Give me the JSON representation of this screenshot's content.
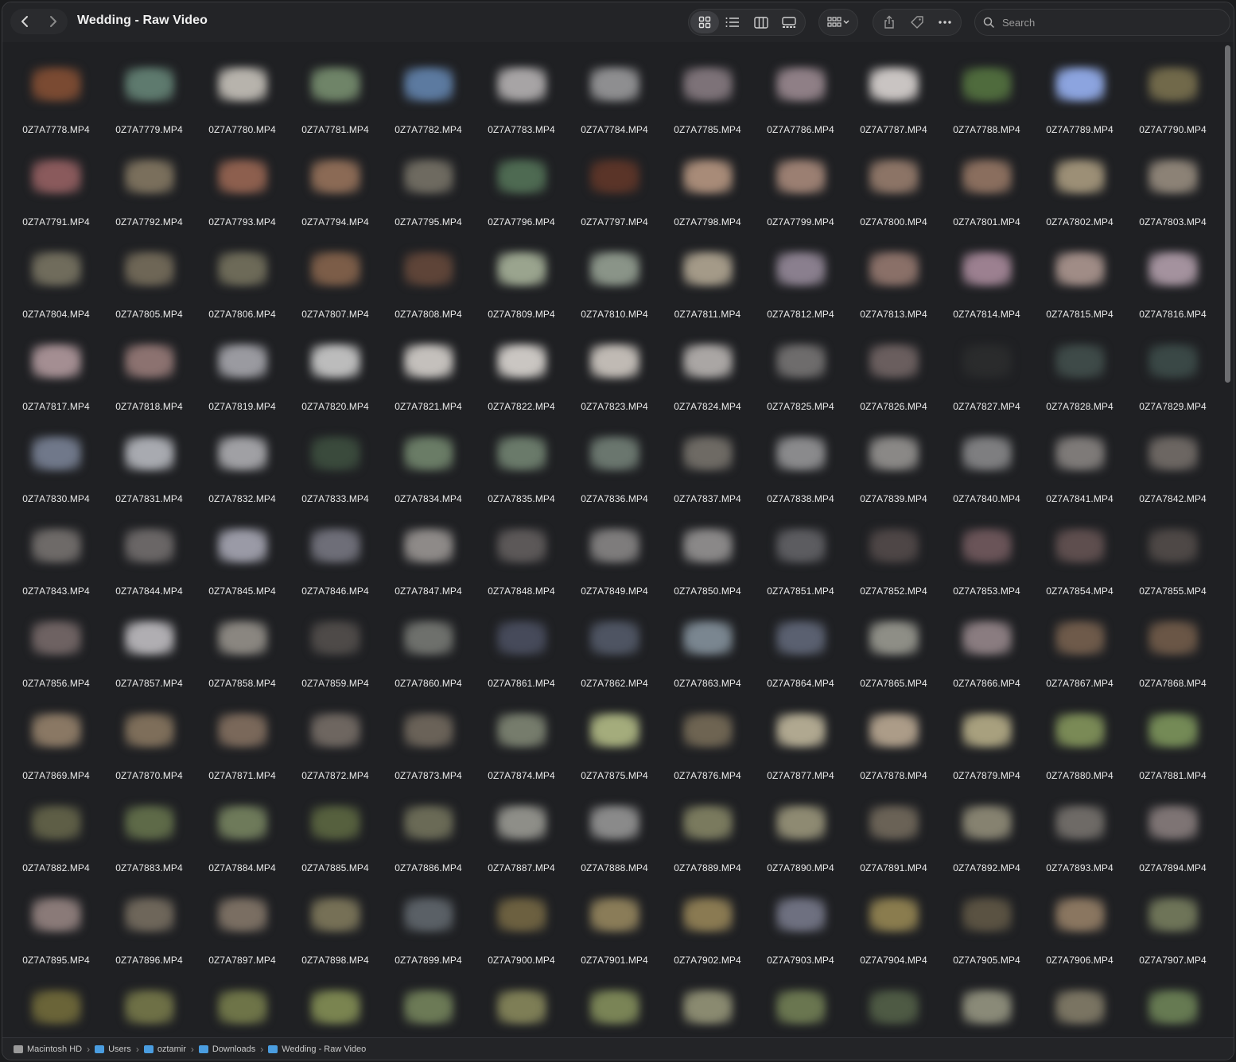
{
  "window": {
    "title": "Wedding - Raw Video"
  },
  "toolbar": {
    "back_icon": "chevron-left-icon",
    "forward_icon": "chevron-right-icon",
    "view_icons": [
      "icon-view-icon",
      "list-view-icon",
      "column-view-icon",
      "gallery-view-icon"
    ],
    "group_icon": "group-by-icon",
    "share_icon": "share-icon",
    "tag_icon": "tag-icon",
    "more_icon": "ellipsis-icon"
  },
  "search": {
    "placeholder": "Search"
  },
  "files": [
    {
      "name": "0Z7A7778.MP4",
      "color": "#7a4a32"
    },
    {
      "name": "0Z7A7779.MP4",
      "color": "#5e7a6e"
    },
    {
      "name": "0Z7A7780.MP4",
      "color": "#b7b3ac"
    },
    {
      "name": "0Z7A7781.MP4",
      "color": "#6f8468"
    },
    {
      "name": "0Z7A7782.MP4",
      "color": "#5c7aa0"
    },
    {
      "name": "0Z7A7783.MP4",
      "color": "#a7a4a5"
    },
    {
      "name": "0Z7A7784.MP4",
      "color": "#8e8e90"
    },
    {
      "name": "0Z7A7785.MP4",
      "color": "#7d7278"
    },
    {
      "name": "0Z7A7786.MP4",
      "color": "#8f7f86"
    },
    {
      "name": "0Z7A7787.MP4",
      "color": "#c9c4c2"
    },
    {
      "name": "0Z7A7788.MP4",
      "color": "#4f6b3d"
    },
    {
      "name": "0Z7A7789.MP4",
      "color": "#8ca4df"
    },
    {
      "name": "0Z7A7790.MP4",
      "color": "#71694a"
    },
    {
      "name": "0Z7A7791.MP4",
      "color": "#8a5a5c"
    },
    {
      "name": "0Z7A7792.MP4",
      "color": "#7a6f5c"
    },
    {
      "name": "0Z7A7793.MP4",
      "color": "#8d5f4e"
    },
    {
      "name": "0Z7A7794.MP4",
      "color": "#8b6a55"
    },
    {
      "name": "0Z7A7795.MP4",
      "color": "#6e6a60"
    },
    {
      "name": "0Z7A7796.MP4",
      "color": "#4e6a52"
    },
    {
      "name": "0Z7A7797.MP4",
      "color": "#5a3428"
    },
    {
      "name": "0Z7A7798.MP4",
      "color": "#a88b78"
    },
    {
      "name": "0Z7A7799.MP4",
      "color": "#9b7f72"
    },
    {
      "name": "0Z7A7800.MP4",
      "color": "#8c7466"
    },
    {
      "name": "0Z7A7801.MP4",
      "color": "#8a6e5e"
    },
    {
      "name": "0Z7A7802.MP4",
      "color": "#9c8f76"
    },
    {
      "name": "0Z7A7803.MP4",
      "color": "#8c8276"
    },
    {
      "name": "0Z7A7804.MP4",
      "color": "#706c5c"
    },
    {
      "name": "0Z7A7805.MP4",
      "color": "#6e6656"
    },
    {
      "name": "0Z7A7806.MP4",
      "color": "#6d6a58"
    },
    {
      "name": "0Z7A7807.MP4",
      "color": "#7c5d48"
    },
    {
      "name": "0Z7A7808.MP4",
      "color": "#5e4438"
    },
    {
      "name": "0Z7A7809.MP4",
      "color": "#9aa48e"
    },
    {
      "name": "0Z7A7810.MP4",
      "color": "#8a9488"
    },
    {
      "name": "0Z7A7811.MP4",
      "color": "#a49a88"
    },
    {
      "name": "0Z7A7812.MP4",
      "color": "#8a7f8e"
    },
    {
      "name": "0Z7A7813.MP4",
      "color": "#8a7068"
    },
    {
      "name": "0Z7A7814.MP4",
      "color": "#9c8090"
    },
    {
      "name": "0Z7A7815.MP4",
      "color": "#a08c86"
    },
    {
      "name": "0Z7A7816.MP4",
      "color": "#a4929e"
    },
    {
      "name": "0Z7A7817.MP4",
      "color": "#a48e92"
    },
    {
      "name": "0Z7A7818.MP4",
      "color": "#8c7270"
    },
    {
      "name": "0Z7A7819.MP4",
      "color": "#9a9aa0"
    },
    {
      "name": "0Z7A7820.MP4",
      "color": "#bcbcbc"
    },
    {
      "name": "0Z7A7821.MP4",
      "color": "#c4c0bc"
    },
    {
      "name": "0Z7A7822.MP4",
      "color": "#cac6c2"
    },
    {
      "name": "0Z7A7823.MP4",
      "color": "#c0bab4"
    },
    {
      "name": "0Z7A7824.MP4",
      "color": "#aaa6a4"
    },
    {
      "name": "0Z7A7825.MP4",
      "color": "#6e6c6c"
    },
    {
      "name": "0Z7A7826.MP4",
      "color": "#6a5e5e"
    },
    {
      "name": "0Z7A7827.MP4",
      "color": "#2a2b2c"
    },
    {
      "name": "0Z7A7828.MP4",
      "color": "#3e4a48"
    },
    {
      "name": "0Z7A7829.MP4",
      "color": "#3a4846"
    },
    {
      "name": "0Z7A7830.MP4",
      "color": "#70788a"
    },
    {
      "name": "0Z7A7831.MP4",
      "color": "#a8aab0"
    },
    {
      "name": "0Z7A7832.MP4",
      "color": "#a0a0a4"
    },
    {
      "name": "0Z7A7833.MP4",
      "color": "#3a4a3c"
    },
    {
      "name": "0Z7A7834.MP4",
      "color": "#6a7c66"
    },
    {
      "name": "0Z7A7835.MP4",
      "color": "#6a7a6a"
    },
    {
      "name": "0Z7A7836.MP4",
      "color": "#6a766e"
    },
    {
      "name": "0Z7A7837.MP4",
      "color": "#6e6a64"
    },
    {
      "name": "0Z7A7838.MP4",
      "color": "#8a8a8c"
    },
    {
      "name": "0Z7A7839.MP4",
      "color": "#8a8886"
    },
    {
      "name": "0Z7A7840.MP4",
      "color": "#7e7e80"
    },
    {
      "name": "0Z7A7841.MP4",
      "color": "#7e7a78"
    },
    {
      "name": "0Z7A7842.MP4",
      "color": "#6c6662"
    },
    {
      "name": "0Z7A7843.MP4",
      "color": "#6e6a68"
    },
    {
      "name": "0Z7A7844.MP4",
      "color": "#6a6666"
    },
    {
      "name": "0Z7A7845.MP4",
      "color": "#9a9aa6"
    },
    {
      "name": "0Z7A7846.MP4",
      "color": "#6e6e78"
    },
    {
      "name": "0Z7A7847.MP4",
      "color": "#8e8a88"
    },
    {
      "name": "0Z7A7848.MP4",
      "color": "#5c5858"
    },
    {
      "name": "0Z7A7849.MP4",
      "color": "#7e7c7c"
    },
    {
      "name": "0Z7A7850.MP4",
      "color": "#8a8888"
    },
    {
      "name": "0Z7A7851.MP4",
      "color": "#5c5c60"
    },
    {
      "name": "0Z7A7852.MP4",
      "color": "#4e4646"
    },
    {
      "name": "0Z7A7853.MP4",
      "color": "#6a5458"
    },
    {
      "name": "0Z7A7854.MP4",
      "color": "#5e4e4e"
    },
    {
      "name": "0Z7A7855.MP4",
      "color": "#4e4846"
    },
    {
      "name": "0Z7A7856.MP4",
      "color": "#6e6262"
    },
    {
      "name": "0Z7A7857.MP4",
      "color": "#b0aeb2"
    },
    {
      "name": "0Z7A7858.MP4",
      "color": "#8a8680"
    },
    {
      "name": "0Z7A7859.MP4",
      "color": "#4e4a48"
    },
    {
      "name": "0Z7A7860.MP4",
      "color": "#6e706c"
    },
    {
      "name": "0Z7A7861.MP4",
      "color": "#464a5a"
    },
    {
      "name": "0Z7A7862.MP4",
      "color": "#4e5462"
    },
    {
      "name": "0Z7A7863.MP4",
      "color": "#7a8690"
    },
    {
      "name": "0Z7A7864.MP4",
      "color": "#5a6070"
    },
    {
      "name": "0Z7A7865.MP4",
      "color": "#8e8e86"
    },
    {
      "name": "0Z7A7866.MP4",
      "color": "#8a7c80"
    },
    {
      "name": "0Z7A7867.MP4",
      "color": "#6e5a4a"
    },
    {
      "name": "0Z7A7868.MP4",
      "color": "#6a5646"
    },
    {
      "name": "0Z7A7869.MP4",
      "color": "#8a7864"
    },
    {
      "name": "0Z7A7870.MP4",
      "color": "#7e6e5a"
    },
    {
      "name": "0Z7A7871.MP4",
      "color": "#7a685a"
    },
    {
      "name": "0Z7A7872.MP4",
      "color": "#6e6660"
    },
    {
      "name": "0Z7A7873.MP4",
      "color": "#6a6258"
    },
    {
      "name": "0Z7A7874.MP4",
      "color": "#767c6c"
    },
    {
      "name": "0Z7A7875.MP4",
      "color": "#a4ac7c"
    },
    {
      "name": "0Z7A7876.MP4",
      "color": "#6e6452"
    },
    {
      "name": "0Z7A7877.MP4",
      "color": "#b0a890"
    },
    {
      "name": "0Z7A7878.MP4",
      "color": "#ac9c88"
    },
    {
      "name": "0Z7A7879.MP4",
      "color": "#a8a07e"
    },
    {
      "name": "0Z7A7880.MP4",
      "color": "#7a8a56"
    },
    {
      "name": "0Z7A7881.MP4",
      "color": "#748a56"
    },
    {
      "name": "0Z7A7882.MP4",
      "color": "#5e5e46"
    },
    {
      "name": "0Z7A7883.MP4",
      "color": "#5e6a48"
    },
    {
      "name": "0Z7A7884.MP4",
      "color": "#6e7a5a"
    },
    {
      "name": "0Z7A7885.MP4",
      "color": "#56603e"
    },
    {
      "name": "0Z7A7886.MP4",
      "color": "#6a6a56"
    },
    {
      "name": "0Z7A7887.MP4",
      "color": "#8e8e88"
    },
    {
      "name": "0Z7A7888.MP4",
      "color": "#8a8a8a"
    },
    {
      "name": "0Z7A7889.MP4",
      "color": "#7a7a5e"
    },
    {
      "name": "0Z7A7890.MP4",
      "color": "#8e8a72"
    },
    {
      "name": "0Z7A7891.MP4",
      "color": "#6a6256"
    },
    {
      "name": "0Z7A7892.MP4",
      "color": "#868270"
    },
    {
      "name": "0Z7A7893.MP4",
      "color": "#6e6a66"
    },
    {
      "name": "0Z7A7894.MP4",
      "color": "#7e7474"
    },
    {
      "name": "0Z7A7895.MP4",
      "color": "#8a7a78"
    },
    {
      "name": "0Z7A7896.MP4",
      "color": "#6e665a"
    },
    {
      "name": "0Z7A7897.MP4",
      "color": "#7a6e62"
    },
    {
      "name": "0Z7A7898.MP4",
      "color": "#767056"
    },
    {
      "name": "0Z7A7899.MP4",
      "color": "#5a6066"
    },
    {
      "name": "0Z7A7900.MP4",
      "color": "#6c6040"
    },
    {
      "name": "0Z7A7901.MP4",
      "color": "#8a7c58"
    },
    {
      "name": "0Z7A7902.MP4",
      "color": "#8a7a52"
    },
    {
      "name": "0Z7A7903.MP4",
      "color": "#6e7080"
    },
    {
      "name": "0Z7A7904.MP4",
      "color": "#8a7c4e"
    },
    {
      "name": "0Z7A7905.MP4",
      "color": "#5a5242"
    },
    {
      "name": "0Z7A7906.MP4",
      "color": "#8a7660"
    },
    {
      "name": "0Z7A7907.MP4",
      "color": "#6e7458"
    },
    {
      "name": "",
      "color": "#6a6438"
    },
    {
      "name": "",
      "color": "#6e7046"
    },
    {
      "name": "",
      "color": "#6e7448"
    },
    {
      "name": "",
      "color": "#7a8450"
    },
    {
      "name": "",
      "color": "#6c7a56"
    },
    {
      "name": "",
      "color": "#7e7e56"
    },
    {
      "name": "",
      "color": "#7a8456"
    },
    {
      "name": "",
      "color": "#8a8a70"
    },
    {
      "name": "",
      "color": "#6a7650"
    },
    {
      "name": "",
      "color": "#4e5a44"
    },
    {
      "name": "",
      "color": "#8a8a78"
    },
    {
      "name": "",
      "color": "#7a7462"
    },
    {
      "name": "",
      "color": "#667a52"
    }
  ],
  "pathbar": {
    "crumbs": [
      {
        "label": "Macintosh HD",
        "icon": "hard-drive-icon"
      },
      {
        "label": "Users",
        "icon": "folder-icon"
      },
      {
        "label": "oztamir",
        "icon": "folder-icon"
      },
      {
        "label": "Downloads",
        "icon": "folder-icon"
      },
      {
        "label": "Wedding - Raw Video",
        "icon": "folder-icon"
      }
    ]
  }
}
